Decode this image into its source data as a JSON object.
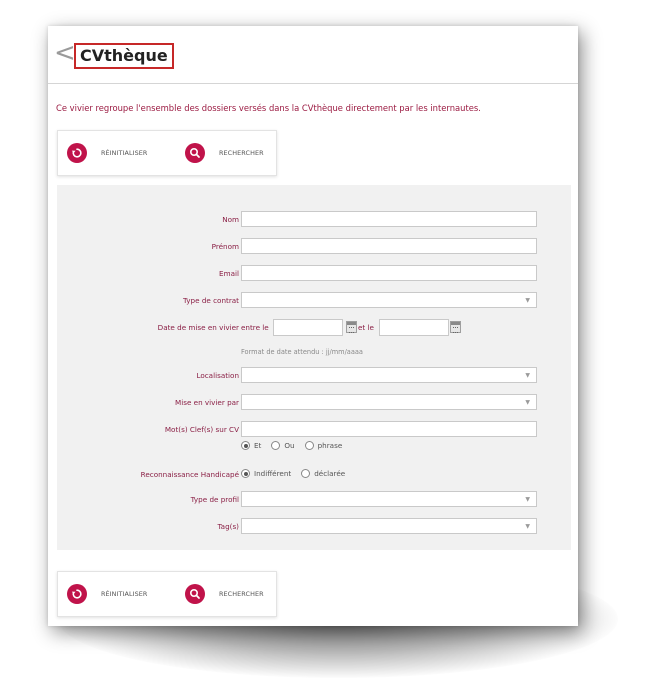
{
  "header": {
    "back_glyph": "<",
    "title": "CVthèque"
  },
  "intro_text": "Ce vivier regroupe l'ensemble des dossiers versés dans la CVthèque directement par les internautes.",
  "toolbar": {
    "reset_label": "RÉINITIALISER",
    "search_label": "RECHERCHER"
  },
  "form": {
    "nom_label": "Nom",
    "prenom_label": "Prénom",
    "email_label": "Email",
    "type_contrat_label": "Type de contrat",
    "date_label": "Date de mise en vivier",
    "date_between": "entre le",
    "date_and": "et le",
    "date_hint": "Format de date attendu : jj/mm/aaaa",
    "localisation_label": "Localisation",
    "mise_par_label": "Mise en vivier par",
    "keywords_label": "Mot(s) Clef(s) sur CV",
    "keyword_options": [
      "Et",
      "Ou",
      "phrase"
    ],
    "keyword_selected": "Et",
    "handicap_label": "Reconnaissance Handicapé",
    "handicap_options": [
      "Indifférent",
      "déclarée"
    ],
    "handicap_selected": "Indifférent",
    "type_profil_label": "Type de profil",
    "tags_label": "Tag(s)"
  },
  "colors": {
    "accent": "#c0134a",
    "label": "#8a1f45",
    "title_border": "#c62828"
  },
  "icons": {
    "back": "chevron-left-icon",
    "reset": "reset-icon",
    "search": "search-icon",
    "calendar": "calendar-icon",
    "dropdown": "chevron-down-icon"
  }
}
